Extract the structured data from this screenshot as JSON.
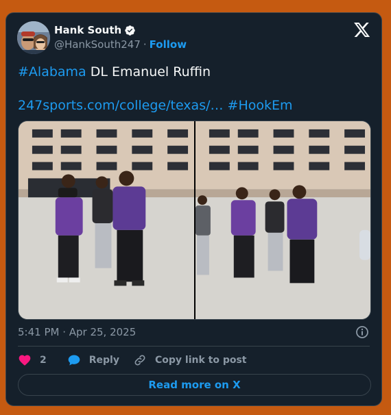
{
  "author": {
    "display_name": "Hank South",
    "handle": "@HankSouth247",
    "separator": "·",
    "follow_label": "Follow",
    "verified": true
  },
  "tweet": {
    "hashtag_1": "#Alabama",
    "text_1": " DL Emanuel Ruffin",
    "link": "247sports.com/college/texas/…",
    "hashtag_2": "#HookEm"
  },
  "media": {
    "photos": [
      "left-photo",
      "right-photo"
    ]
  },
  "meta": {
    "timestamp": "5:41 PM · Apr 25, 2025"
  },
  "actions": {
    "like_count": "2",
    "reply_label": "Reply",
    "copy_link_label": "Copy link to post"
  },
  "footer": {
    "read_more_label": "Read more on X"
  },
  "colors": {
    "page_background": "#c55a11",
    "card_background": "#15202b",
    "link": "#1d9bf0",
    "like": "#f91880",
    "secondary_text": "#8b98a5"
  },
  "icons": [
    "verified-badge-icon",
    "x-logo-icon",
    "info-icon",
    "heart-icon",
    "reply-bubble-icon",
    "link-icon"
  ]
}
